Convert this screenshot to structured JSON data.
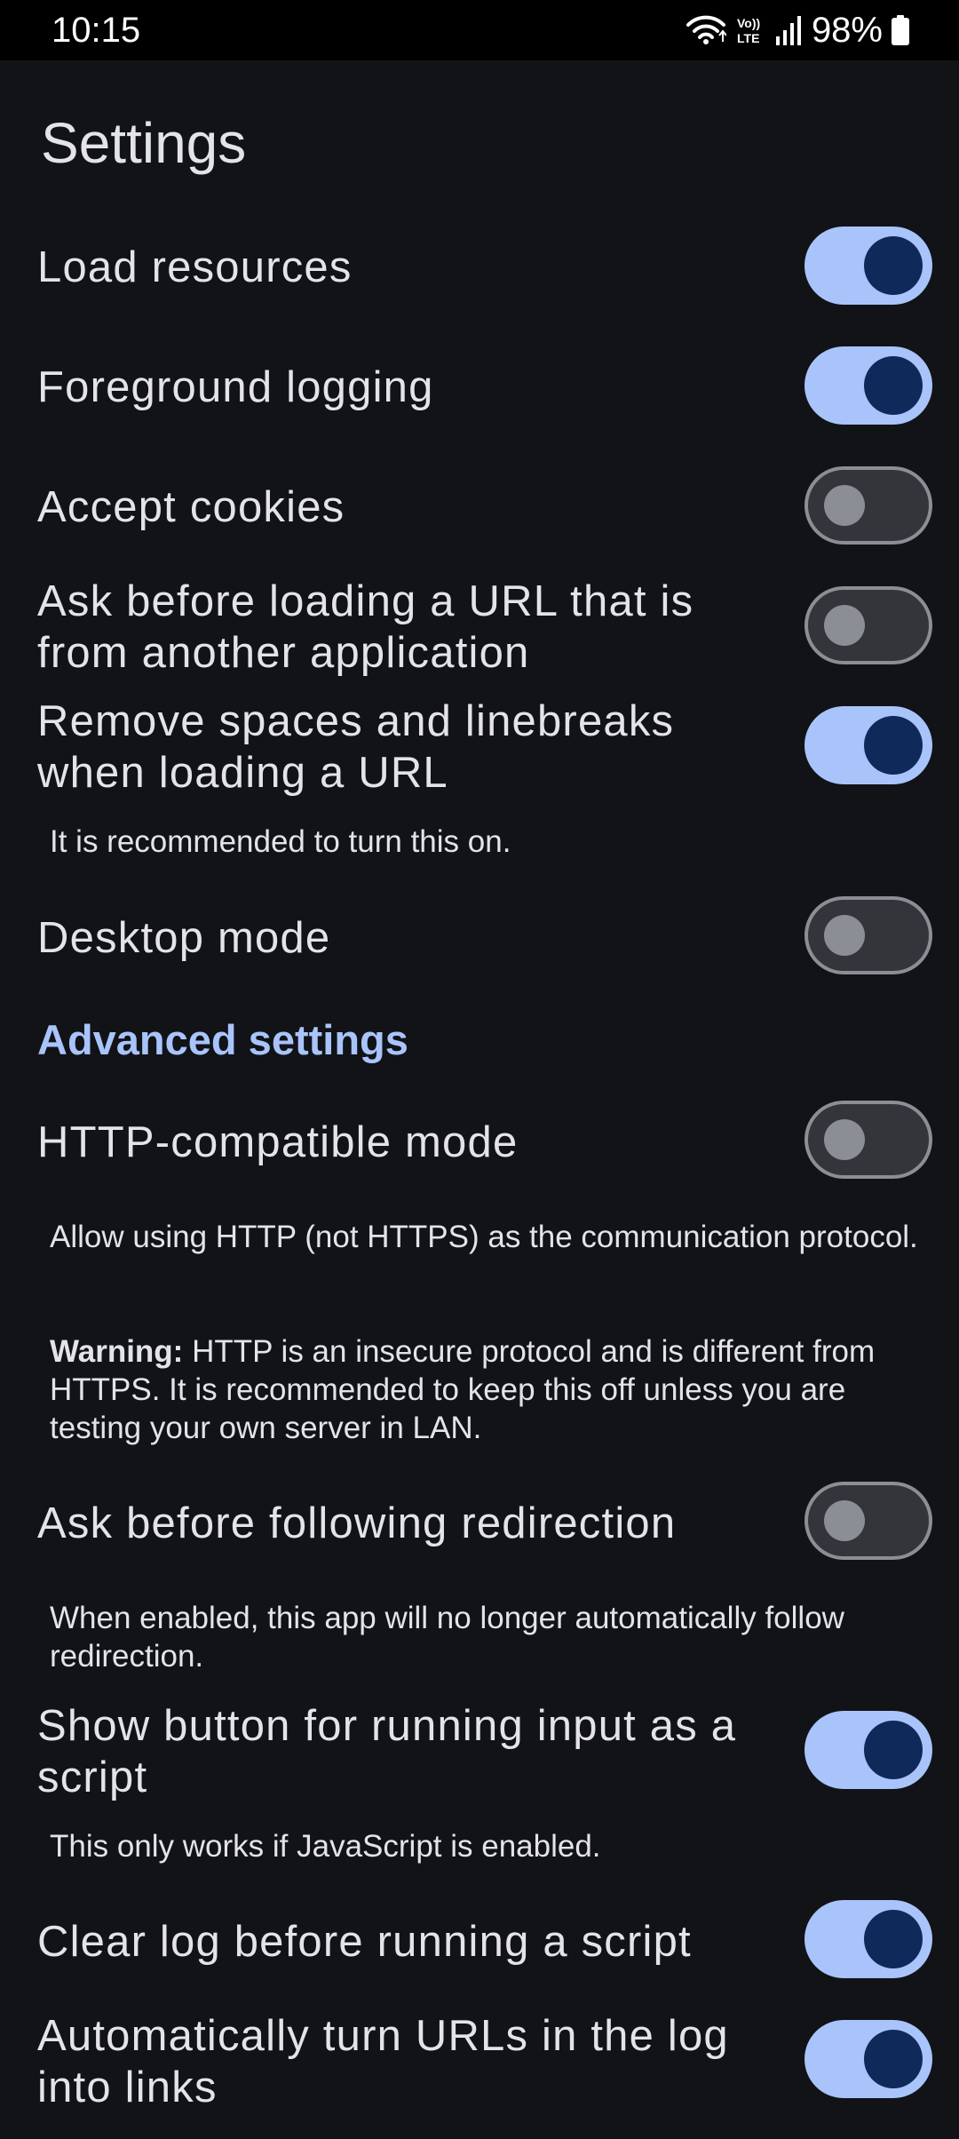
{
  "status_bar": {
    "time": "10:15",
    "battery": "98%",
    "network_label": "Vo)) LTE",
    "icons": [
      "wifi-icon",
      "volte-icon",
      "signal-icon",
      "battery-icon"
    ]
  },
  "page": {
    "title": "Settings"
  },
  "settings": [
    {
      "id": "load-resources",
      "label": "Load resources",
      "enabled": true
    },
    {
      "id": "foreground-logging",
      "label": "Foreground logging",
      "enabled": true
    },
    {
      "id": "accept-cookies",
      "label": "Accept cookies",
      "enabled": false
    },
    {
      "id": "ask-before-loading-url",
      "label": "Ask before loading a URL that is from another application",
      "enabled": false
    },
    {
      "id": "remove-spaces",
      "label": "Remove spaces and linebreaks when loading a URL",
      "enabled": true,
      "description": "It is recommended to turn this on."
    },
    {
      "id": "desktop-mode",
      "label": "Desktop mode",
      "enabled": false
    }
  ],
  "advanced": {
    "header": "Advanced settings",
    "items": [
      {
        "id": "http-compatible-mode",
        "label": "HTTP-compatible mode",
        "enabled": false,
        "description": "Allow using HTTP (not HTTPS) as the communication protocol.",
        "warning_label": "Warning:",
        "warning_text": " HTTP is an insecure protocol and is different from HTTPS. It is recommended to keep this off unless you are testing your own server in LAN."
      },
      {
        "id": "ask-before-redirection",
        "label": "Ask before following redirection",
        "enabled": false,
        "description": "When enabled, this app will no longer automatically follow redirection."
      },
      {
        "id": "show-run-script-button",
        "label": "Show button for running input as a script",
        "enabled": true,
        "description": "This only works if JavaScript is enabled."
      },
      {
        "id": "clear-log",
        "label": "Clear log before running a script",
        "enabled": true
      },
      {
        "id": "auto-links",
        "label": "Automatically turn URLs in the log into links",
        "enabled": true
      }
    ]
  },
  "colors": {
    "background": "#111317",
    "accent": "#a9c4fb",
    "toggle_on_thumb": "#10295b",
    "toggle_off_track": "#33353b",
    "toggle_off_outline": "#8c8e95"
  }
}
